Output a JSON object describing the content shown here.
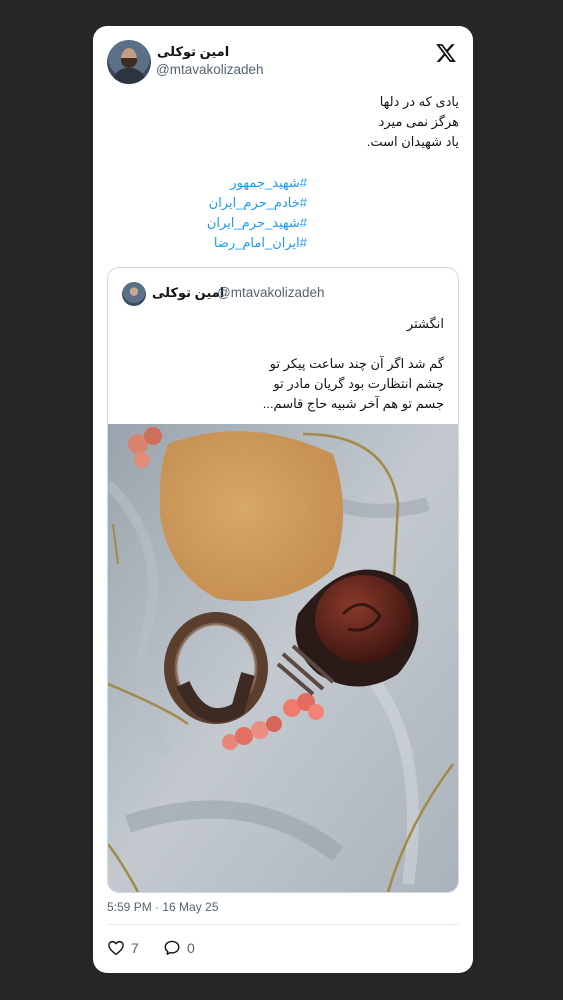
{
  "author": {
    "name": "امین توکلی",
    "handle": "@mtavakolizadeh"
  },
  "brand": {
    "logo_icon": "x-logo-icon"
  },
  "tweet": {
    "lines": [
      "یادی که در دلها",
      "هرگز نمی میرد",
      "یاد شهیدان است."
    ],
    "hashtags": [
      "#شهید_جمهور",
      "#خادم_حرم_ایران",
      "#شهید_حرم_ایران",
      "#ایران_امام_رضا"
    ]
  },
  "quote": {
    "name": "امین توکلی",
    "handle": "@mtavakolizadeh",
    "title": "انگشتر",
    "lines": [
      "گم شد اگر آن چند ساعت پیکر تو",
      "چشم انتظارت بود گریان مادر تو",
      "جسم تو هم آخر شبیه حاج قاسم..."
    ]
  },
  "meta": {
    "timestamp": "5:59 PM · 16 May 25",
    "likes": "7",
    "replies": "0"
  },
  "colors": {
    "hashtag": "#1d9bf0",
    "text": "#0f1419",
    "muted": "#536471",
    "background": "#262626"
  }
}
